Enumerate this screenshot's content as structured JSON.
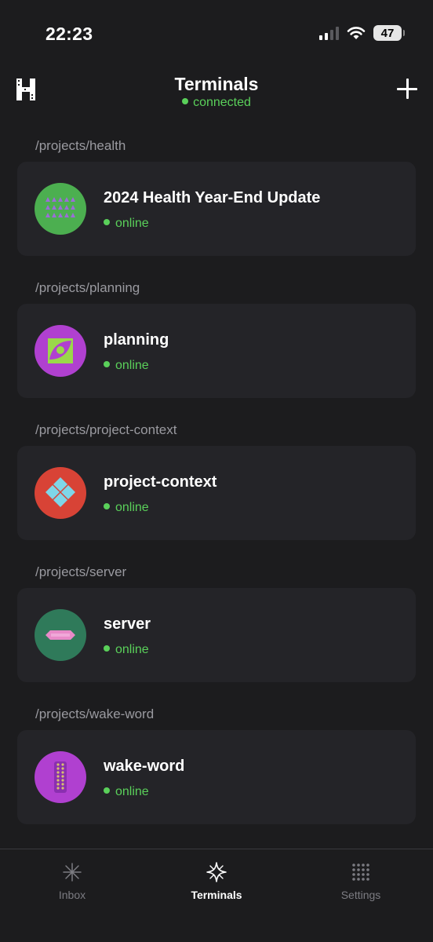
{
  "status_bar": {
    "time": "22:23",
    "battery": "47"
  },
  "header": {
    "title": "Terminals",
    "status": "connected"
  },
  "sections": [
    {
      "path": "/projects/health",
      "name": "2024 Health Year-End Update",
      "status": "online"
    },
    {
      "path": "/projects/planning",
      "name": "planning",
      "status": "online"
    },
    {
      "path": "/projects/project-context",
      "name": "project-context",
      "status": "online"
    },
    {
      "path": "/projects/server",
      "name": "server",
      "status": "online"
    },
    {
      "path": "/projects/wake-word",
      "name": "wake-word",
      "status": "online"
    }
  ],
  "tabs": [
    {
      "label": "Inbox",
      "icon": "spark-icon",
      "active": false
    },
    {
      "label": "Terminals",
      "icon": "diamond-star-icon",
      "active": true
    },
    {
      "label": "Settings",
      "icon": "dots-grid-icon",
      "active": false
    }
  ],
  "colors": {
    "accent_green": "#5ad05a",
    "background": "#1c1c1e",
    "card": "#242428",
    "avatar_health": "#4caf50",
    "avatar_planning": "#b040d0",
    "avatar_project_context": "#d84336",
    "avatar_server": "#2f7a5a",
    "avatar_wake_word": "#b040d0"
  }
}
